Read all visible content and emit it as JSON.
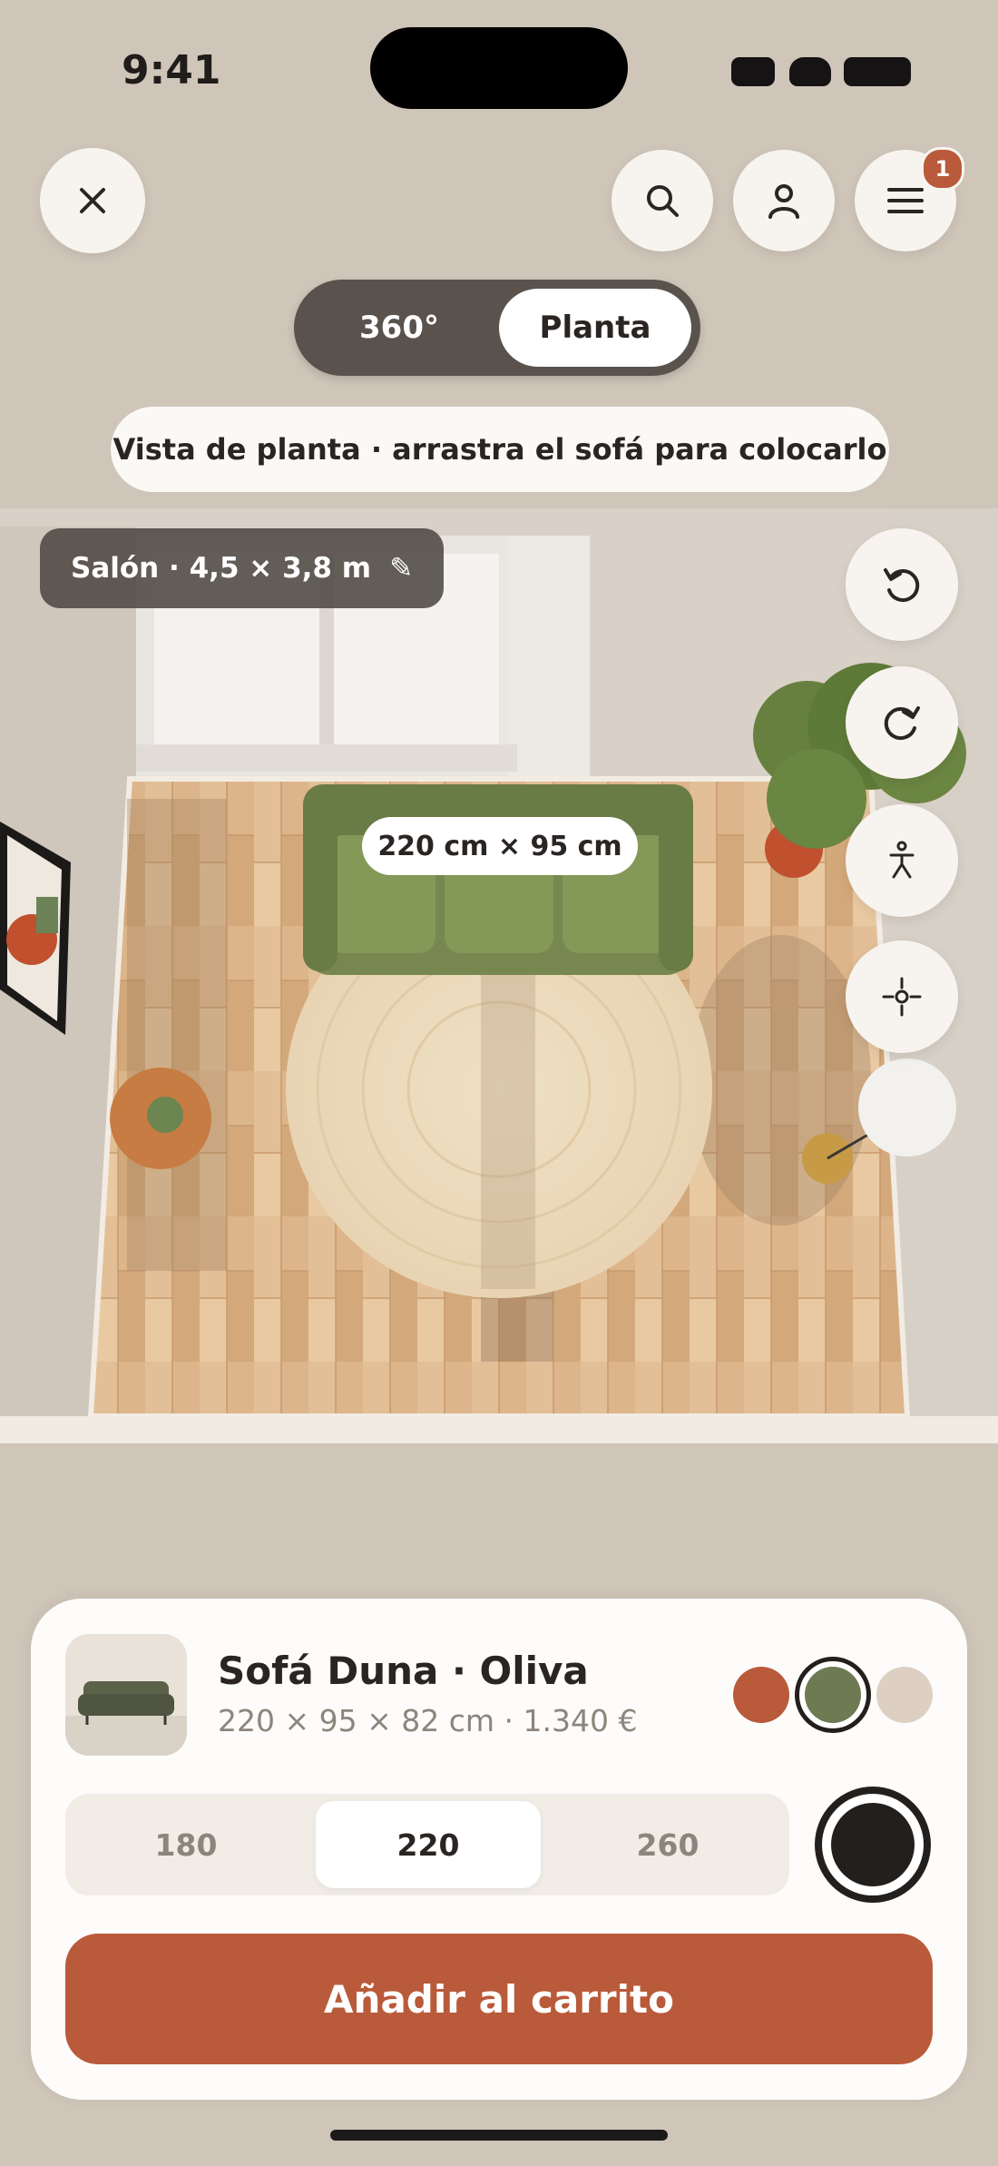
{
  "status_bar": {
    "time": "9:41"
  },
  "header": {
    "close_icon": "close-icon",
    "search_icon": "search-icon",
    "profile_icon": "person-icon",
    "menu_icon": "menu-icon",
    "menu_badge": "1"
  },
  "view_toggle": {
    "options": [
      "360°",
      "Planta"
    ],
    "selected": "Planta"
  },
  "hint": "Vista de planta · arrastra el sofá para colocarlo",
  "room": {
    "label": "Salón · 4,5 × 3,8 m",
    "edit_icon": "✎"
  },
  "sofa_dimension_label": "220 cm × 95 cm",
  "tools": [
    "rotate-left-icon",
    "rotate-right-icon",
    "person-scale-icon",
    "crosshair-icon"
  ],
  "product": {
    "title": "Sofá Duna · Oliva",
    "subtitle": "220 × 95 × 82 cm · 1.340 €",
    "colors": [
      {
        "name": "terracota",
        "hex": "#b95a3a"
      },
      {
        "name": "oliva",
        "hex": "#6d7a52",
        "selected": true
      },
      {
        "name": "arena",
        "hex": "#ddd0c2"
      }
    ],
    "sizes": [
      "180",
      "220",
      "260"
    ],
    "selected_size": "220",
    "extra_color": "#231f1d",
    "add_to_cart": "Añadir al carrito"
  },
  "colors": {
    "accent": "#b95a3a",
    "background": "#cfc5b9",
    "sofa": "#7a8a52",
    "floor": "#dbb58a"
  }
}
